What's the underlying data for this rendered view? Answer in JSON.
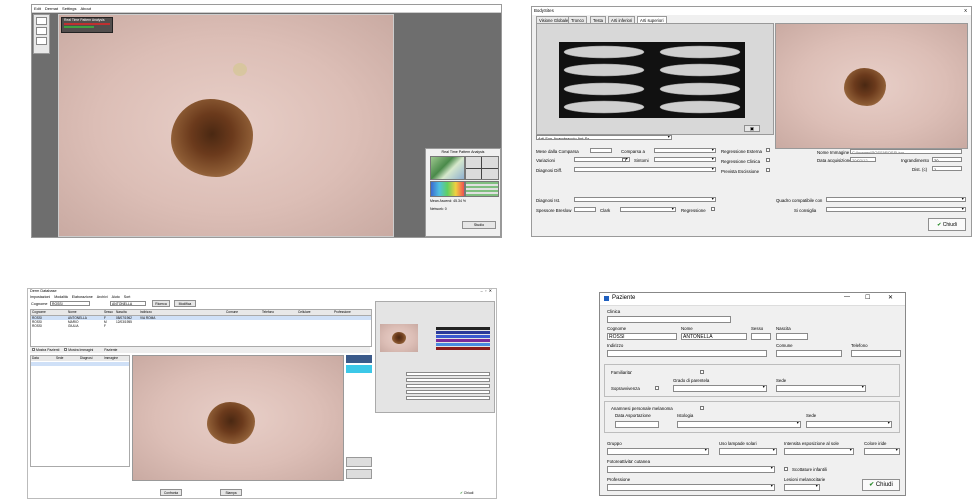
{
  "viewer": {
    "menu": [
      "Edit",
      "Dermat",
      "Settings",
      "About"
    ],
    "overlay_title": "Real Time Pattern Analysis",
    "analysis_title": "Real Time Pattern Analysis",
    "analysis_lines": [
      "Mean Ascend: 45.34 %",
      "Network: 0"
    ],
    "btn_label": "Studio"
  },
  "bodysites": {
    "window_title": "BodySites",
    "close_glyph": "X",
    "tabs": [
      "Visione Globale",
      "Tronco",
      "Testa",
      "Arti inferiori",
      "Arti superiori"
    ],
    "region_select": "Arti Sup-Avambraccio Ant Sx",
    "labels": {
      "comparsa": "Mese dalla Comparsa",
      "comparsa_a": "Comparsa a",
      "variazioni": "Variazioni",
      "sintomi": "Sintomi",
      "diagnosi_diff": "Diagnosi Diff.",
      "diagnosi_ist": "Diagnosi Ist.",
      "spessore": "Spessore Breslow",
      "clark": "Clark",
      "regressione": "Regressione",
      "reg_esterna": "Regressione Esterna",
      "reg_clinica": "Regressione Clinica",
      "prevista": "Prevista Escissione",
      "nome_immagine": "Nome Immagine",
      "data_acq": "Data acquisizione",
      "ingrandimento": "Ingrandimento",
      "dist": "Dist. (c)",
      "quadro": "Quadro compatibile con",
      "consiglio": "Si consiglia"
    },
    "values": {
      "nome_immagine": "C:\\Images\\ROSSI\\ROSSI.jpg",
      "data_acq": "20/02/12",
      "ingrandimento": "20",
      "dist": "1"
    },
    "close_button": "Chiudi"
  },
  "mainapp": {
    "window_title": "Derm Database",
    "menu": [
      "Impostazioni",
      "Modalità",
      "Elaborazione",
      "Archivi",
      "Aiuto",
      "Sort"
    ],
    "search_label": "Cognome",
    "search_value": "ROSSI",
    "name_value": "ANTONELLA",
    "toolbar_buttons": [
      "Ricerca",
      "Modifica"
    ],
    "table_headers": [
      "Cognome",
      "Nome",
      "Sesso",
      "Nascita",
      "Indirizzo",
      "Comune",
      "Telefono",
      "Cellulare",
      "Professione"
    ],
    "table_rows": [
      [
        "ROSSI",
        "ANTONELLA",
        "F",
        "08/07/1962",
        "VIA ROMA"
      ],
      [
        "ROSSI",
        "MARIO",
        "M",
        "12/03/1955",
        ""
      ],
      [
        "ROSSI",
        "GIULIA",
        "F",
        "",
        ""
      ]
    ],
    "filter_checks": [
      "Mostra Pazienti",
      "Mostra Immagini"
    ],
    "patient_label": "Paziente",
    "image_list_headers": [
      "Data",
      "Sede",
      "Diagnosi",
      "Immagine"
    ],
    "bottom_buttons": [
      "Confronta",
      "Stampa",
      "Chiudi"
    ]
  },
  "paziente": {
    "window_title": "Paziente",
    "controls": [
      "—",
      "☐",
      "✕"
    ],
    "clinica": "Clinica",
    "cognome": "Cognome",
    "cognome_value": "ROSSI",
    "nome": "Nome",
    "nome_value": "ANTONELLA",
    "sesso": "Sesso",
    "nascita": "Nascita",
    "indirizzo": "Indirizzo",
    "comune": "Comune",
    "telefono": "Telefono",
    "familiarita": "Familiarita'",
    "grado": "Grado di parentela",
    "sopravvivenza": "Sopravvivenza",
    "sede": "Sede",
    "anamnesi": "Anamnesi personale melanoma",
    "data_asportazione": "Data Asportazione",
    "istologia": "Istologia",
    "sede2": "Sede",
    "gruppo": "Gruppo",
    "lampade": "Uso lampade solari",
    "esposizione": "Intensita esposizione al sole",
    "colore_iride": "Colore iride",
    "fotoreattivita": "Fotoreattivita' cutanea",
    "scottature": "Scottature infantili",
    "professione": "Professione",
    "lesioni": "Lesioni melanocitarie",
    "close_button": "Chiudi"
  }
}
